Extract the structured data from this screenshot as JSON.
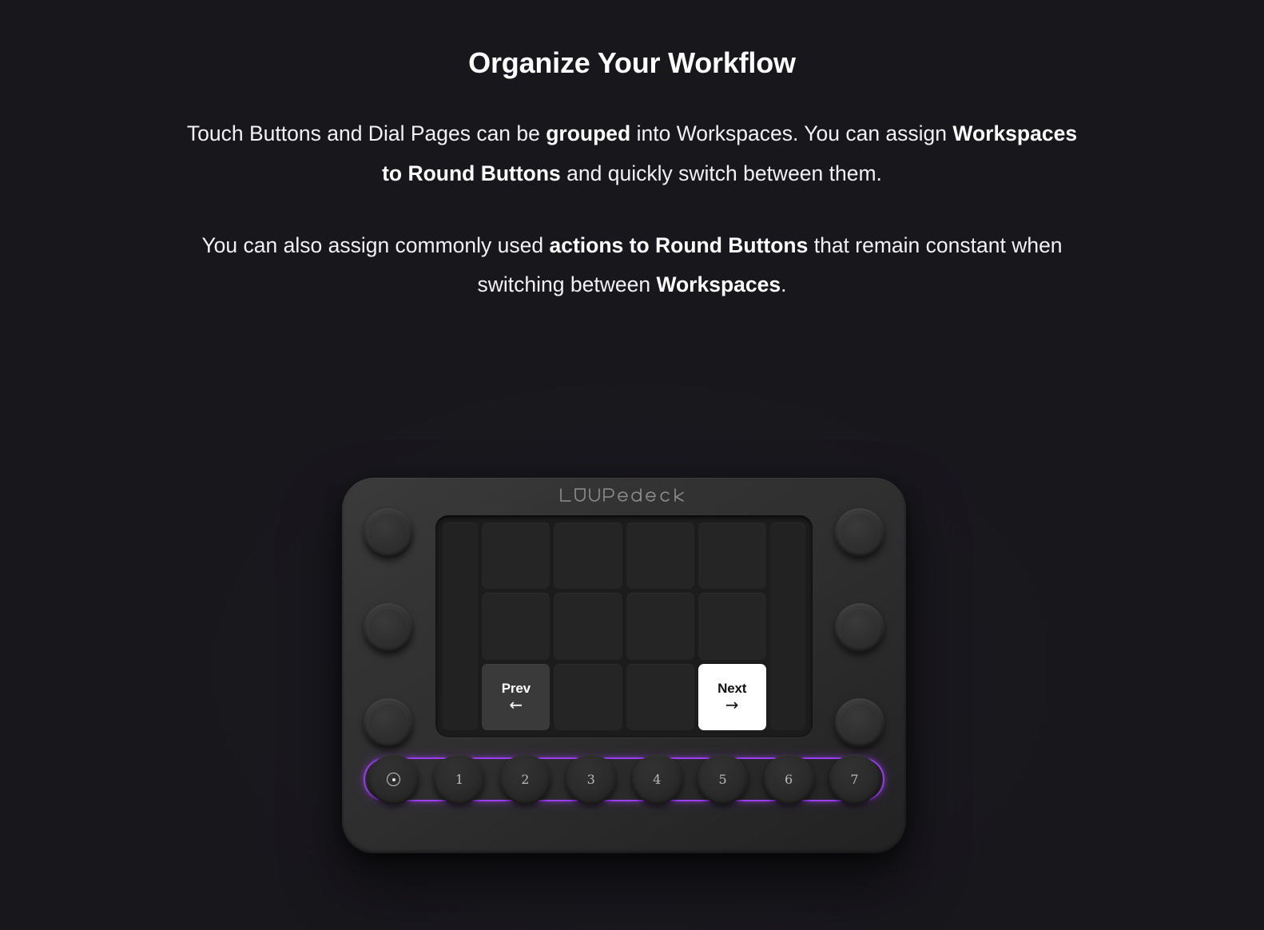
{
  "theme": {
    "background": "#18171c",
    "accent_purple": "#9b3ff0",
    "device_body": "#2e2e2e",
    "panel_bg": "#1c1c1c",
    "pad_bg": "#252525",
    "text": "#ffffff"
  },
  "headline": "Organize Your Workflow",
  "paragraphs": [
    {
      "id": "p1",
      "segments": [
        {
          "text": "Touch Buttons and Dial Pages can be ",
          "bold": false
        },
        {
          "text": "grouped",
          "bold": true
        },
        {
          "text": " into Workspaces. You can assign ",
          "bold": false
        },
        {
          "text": "Workspaces to Round Buttons",
          "bold": true
        },
        {
          "text": " and quickly switch between them.",
          "bold": false
        }
      ]
    },
    {
      "id": "p2",
      "segments": [
        {
          "text": "You can also assign commonly used ",
          "bold": false
        },
        {
          "text": "actions to Round Buttons",
          "bold": true
        },
        {
          "text": " that remain constant when switching between ",
          "bold": false
        },
        {
          "text": "Workspaces",
          "bold": true
        },
        {
          "text": ".",
          "bold": false
        }
      ]
    }
  ],
  "device": {
    "brand": "Loupedeck",
    "dials": {
      "left": [
        {
          "name": "dial-left-1",
          "label": ""
        },
        {
          "name": "dial-left-2",
          "label": ""
        },
        {
          "name": "dial-left-3",
          "label": ""
        }
      ],
      "right": [
        {
          "name": "dial-right-1",
          "label": ""
        },
        {
          "name": "dial-right-2",
          "label": ""
        },
        {
          "name": "dial-right-3",
          "label": ""
        }
      ]
    },
    "touch_grid": {
      "columns": 6,
      "rows": 3,
      "cells": [
        {
          "pos": "left-strip",
          "type": "side",
          "label": "",
          "arrow": "",
          "state": "empty"
        },
        {
          "pos": "r1c1",
          "type": "pad",
          "label": "",
          "arrow": "",
          "state": "empty"
        },
        {
          "pos": "r1c2",
          "type": "pad",
          "label": "",
          "arrow": "",
          "state": "empty"
        },
        {
          "pos": "r1c3",
          "type": "pad",
          "label": "",
          "arrow": "",
          "state": "empty"
        },
        {
          "pos": "r1c4",
          "type": "pad",
          "label": "",
          "arrow": "",
          "state": "empty"
        },
        {
          "pos": "right-strip",
          "type": "side",
          "label": "",
          "arrow": "",
          "state": "empty"
        },
        {
          "pos": "r2c1",
          "type": "pad",
          "label": "",
          "arrow": "",
          "state": "empty"
        },
        {
          "pos": "r2c2",
          "type": "pad",
          "label": "",
          "arrow": "",
          "state": "empty"
        },
        {
          "pos": "r2c3",
          "type": "pad",
          "label": "",
          "arrow": "",
          "state": "empty"
        },
        {
          "pos": "r2c4",
          "type": "pad",
          "label": "",
          "arrow": "",
          "state": "empty"
        },
        {
          "pos": "r3c1",
          "type": "pad",
          "label": "Prev",
          "arrow": "←",
          "state": "dark-active"
        },
        {
          "pos": "r3c2",
          "type": "pad",
          "label": "",
          "arrow": "",
          "state": "empty"
        },
        {
          "pos": "r3c3",
          "type": "pad",
          "label": "",
          "arrow": "",
          "state": "empty"
        },
        {
          "pos": "r3c4",
          "type": "pad",
          "label": "Next",
          "arrow": "→",
          "state": "light-active"
        }
      ]
    },
    "round_buttons": {
      "highlighted": true,
      "items": [
        {
          "name": "round-button-home",
          "label": "",
          "icon": "circle-dot-icon"
        },
        {
          "name": "round-button-1",
          "label": "1",
          "icon": ""
        },
        {
          "name": "round-button-2",
          "label": "2",
          "icon": ""
        },
        {
          "name": "round-button-3",
          "label": "3",
          "icon": ""
        },
        {
          "name": "round-button-4",
          "label": "4",
          "icon": ""
        },
        {
          "name": "round-button-5",
          "label": "5",
          "icon": ""
        },
        {
          "name": "round-button-6",
          "label": "6",
          "icon": ""
        },
        {
          "name": "round-button-7",
          "label": "7",
          "icon": ""
        }
      ]
    }
  }
}
